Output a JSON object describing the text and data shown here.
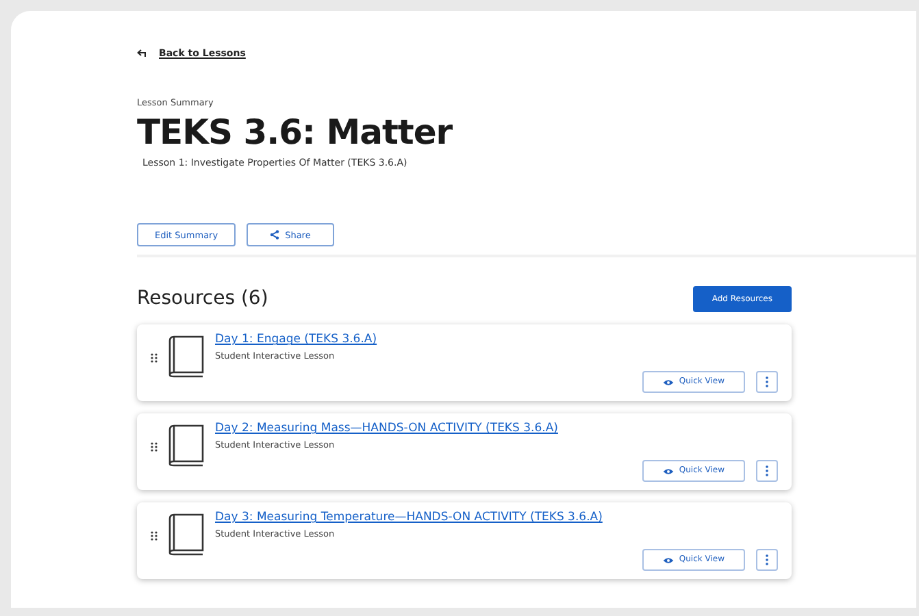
{
  "back_link": "Back to Lessons",
  "eyebrow": "Lesson Summary",
  "title": "TEKS 3.6: Matter",
  "subtitle": "Lesson 1: Investigate Properties Of Matter (TEKS 3.6.A)",
  "actions": [
    {
      "kind": "plain",
      "label": "Edit Summary"
    },
    {
      "kind": "share",
      "label": "Share"
    }
  ],
  "resources": {
    "heading": "Resources (6)",
    "add_button": "Add Resources",
    "items": [
      {
        "title": "Day 1: Engage (TEKS 3.6.A)",
        "type": "Student Interactive Lesson",
        "quick_view": "Quick View"
      },
      {
        "title": "Day 2: Measuring Mass—HANDS-ON ACTIVITY (TEKS 3.6.A)",
        "type": "Student Interactive Lesson",
        "quick_view": "Quick View"
      },
      {
        "title": "Day 3: Measuring Temperature—HANDS-ON ACTIVITY (TEKS 3.6.A)",
        "type": "Student Interactive Lesson",
        "quick_view": "Quick View"
      }
    ]
  }
}
